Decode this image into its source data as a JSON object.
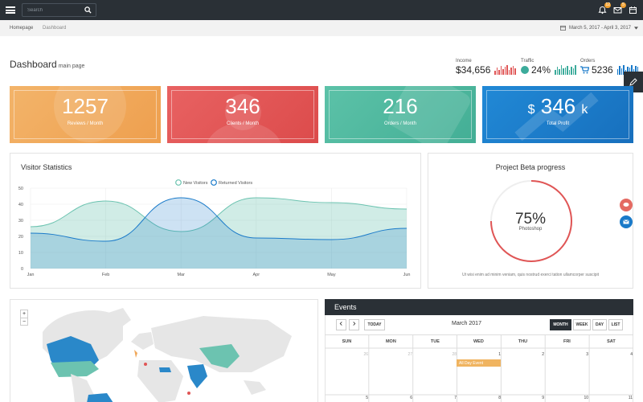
{
  "topbar": {
    "search_placeholder": "Search",
    "notifications_count": "12",
    "messages_count": "5"
  },
  "breadcrumb": {
    "items": [
      "Homepage",
      "Dashboard"
    ],
    "date_range": "March 5, 2017 - April 3, 2017"
  },
  "header": {
    "title": "Dashboard",
    "subtitle": "main page"
  },
  "stats": [
    {
      "label": "Income",
      "value": "$34,656",
      "color": "#e05555"
    },
    {
      "label": "Traffic",
      "value": "24%",
      "color": "#3cab9b"
    },
    {
      "label": "Orders",
      "value": "5236",
      "color": "#1a7ac9"
    }
  ],
  "cards": [
    {
      "value": "1257",
      "label": "Reviews / Month",
      "color": "#f0a85a"
    },
    {
      "value": "346",
      "label": "Clients / Month",
      "color": "#e05555"
    },
    {
      "value": "216",
      "label": "Orders / Month",
      "color": "#4fb99f"
    },
    {
      "prefix": "$",
      "value": "346",
      "suffix": "k",
      "label": "Total Profit",
      "color": "#1a7ac9"
    }
  ],
  "visitor_stats": {
    "title": "Visitor Statistics",
    "chart_data": {
      "type": "area",
      "categories": [
        "Jan",
        "Feb",
        "Mar",
        "Apr",
        "May",
        "Jun"
      ],
      "ylim": [
        0,
        50
      ],
      "yticks": [
        0,
        10,
        20,
        30,
        40,
        50
      ],
      "series": [
        {
          "name": "New Visitors",
          "values": [
            26,
            42,
            23,
            44,
            41,
            37
          ],
          "color": "#6cc3b0"
        },
        {
          "name": "Returned Visitors",
          "values": [
            22,
            17,
            44,
            19,
            18,
            25
          ],
          "color": "#1a7ac9"
        }
      ]
    }
  },
  "project": {
    "title": "Project Beta progress",
    "percent_label": "75%",
    "progress": 0.75,
    "caption": "Photoshop",
    "description": "Ut wisi enim ad minim veniam, quis nostrud exerci tation ullamcorper suscipit"
  },
  "events": {
    "title": "Events",
    "month": "March 2017",
    "today_label": "TODAY",
    "views": [
      "MONTH",
      "WEEK",
      "DAY",
      "LIST"
    ],
    "active_view": "MONTH",
    "weekdays": [
      "SUN",
      "MON",
      "TUE",
      "WED",
      "THU",
      "FRI",
      "SAT"
    ],
    "week1": [
      "26",
      "27",
      "28",
      "1",
      "2",
      "3",
      "4"
    ],
    "week2": [
      "5",
      "6",
      "7",
      "8",
      "9",
      "10",
      "11"
    ],
    "event_label": "All Day Event"
  },
  "map_controls": {
    "zoom_in": "+",
    "zoom_out": "−"
  }
}
